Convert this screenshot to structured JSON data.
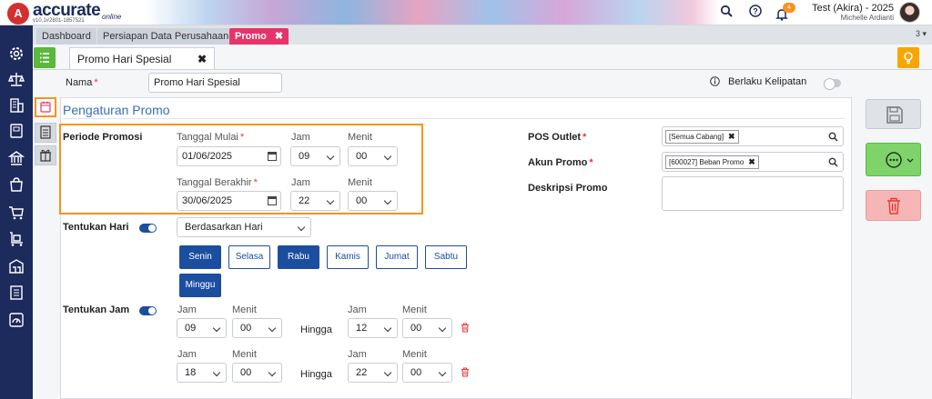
{
  "header": {
    "logo_letter": "A",
    "brand": "accurate",
    "brand_sub": "online",
    "version": "v10.1#2801-1857521",
    "notif_count": "4",
    "user_name": "Test (Akira) - 2025",
    "user_sub": "Michelle Ardianti",
    "icons": [
      "search-icon",
      "help-icon",
      "bell-icon"
    ]
  },
  "sidebar": {
    "icons": [
      "gear-icon",
      "scale-icon",
      "building-icon",
      "ledger-icon",
      "bank-icon",
      "bag-icon",
      "cart-icon",
      "truck-cart-icon",
      "warehouse-icon",
      "report-icon",
      "gauge-icon"
    ]
  },
  "tabs": {
    "items": [
      {
        "label": "Dashboard"
      },
      {
        "label": "Persiapan Data Perusahaan"
      },
      {
        "label": "Promo",
        "close": "✖"
      }
    ],
    "count": "3"
  },
  "form": {
    "subtab_label": "Promo Hari Spesial",
    "subtab_close": "✖",
    "nama_label": "Nama",
    "nama_value": "Promo Hari Spesial",
    "berlaku_label": "Berlaku Kelipatan",
    "berlaku_on": false,
    "section_title": "Pengaturan Promo",
    "required_mark": "*"
  },
  "periode": {
    "label": "Periode Promosi",
    "mulai_label": "Tanggal Mulai",
    "mulai_value": "01/06/2025",
    "mulai_jam_label": "Jam",
    "mulai_jam": "09",
    "mulai_menit_label": "Menit",
    "mulai_menit": "00",
    "akhir_label": "Tanggal Berakhir",
    "akhir_value": "30/06/2025",
    "akhir_jam_label": "Jam",
    "akhir_jam": "22",
    "akhir_menit_label": "Menit",
    "akhir_menit": "00"
  },
  "hari": {
    "label": "Tentukan Hari",
    "enabled": true,
    "mode": "Berdasarkan Hari",
    "days": [
      {
        "label": "Senin",
        "on": true
      },
      {
        "label": "Selasa",
        "on": false
      },
      {
        "label": "Rabu",
        "on": true
      },
      {
        "label": "Kamis",
        "on": false
      },
      {
        "label": "Jumat",
        "on": false
      },
      {
        "label": "Sabtu",
        "on": false
      },
      {
        "label": "Minggu",
        "on": true
      }
    ]
  },
  "jam": {
    "label": "Tentukan Jam",
    "enabled": true,
    "rows": [
      {
        "jam_label": "Jam",
        "menit_label": "Menit",
        "from_jam": "09",
        "from_menit": "00",
        "hingga": "Hingga",
        "to_jam_label": "Jam",
        "to_menit_label": "Menit",
        "to_jam": "12",
        "to_menit": "00"
      },
      {
        "jam_label": "Jam",
        "menit_label": "Menit",
        "from_jam": "18",
        "from_menit": "00",
        "hingga": "Hingga",
        "to_jam_label": "Jam",
        "to_menit_label": "Menit",
        "to_jam": "22",
        "to_menit": "00"
      }
    ]
  },
  "right": {
    "pos_outlet_label": "POS Outlet",
    "pos_outlet_tag": "[Semua Cabang]",
    "akun_label": "Akun Promo",
    "akun_tag": "[600027] Beban Promo",
    "tag_close": "✖",
    "deskripsi_label": "Deskripsi Promo",
    "deskripsi_value": ""
  },
  "colors": {
    "accent": "#1c4ea0",
    "sidebar": "#1c2a5c",
    "tab_active": "#e8336a",
    "highlight": "#f7931e",
    "save_btn": "#dfe3e8",
    "more_btn": "#7fd36b",
    "delete_btn": "#f6b6b6"
  }
}
